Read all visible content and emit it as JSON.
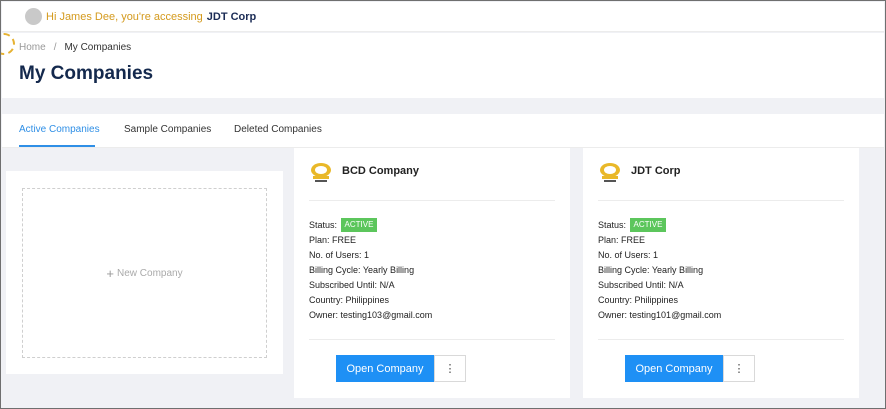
{
  "topbar": {
    "greeting": "Hi James Dee, you're accessing",
    "company": "JDT Corp"
  },
  "breadcrumb": {
    "home": "Home",
    "separator": "/",
    "current": "My Companies"
  },
  "page": {
    "title": "My Companies"
  },
  "tabs": [
    {
      "label": "Active Companies",
      "active": true
    },
    {
      "label": "Sample Companies",
      "active": false
    },
    {
      "label": "Deleted Companies",
      "active": false
    }
  ],
  "new_company": {
    "plus": "+",
    "label": "New Company"
  },
  "labels": {
    "status": "Status:",
    "plan": "Plan:",
    "users": "No. of Users:",
    "billing": "Billing Cycle:",
    "subscribed": "Subscribed Until:",
    "country": "Country:",
    "owner": "Owner:",
    "open": "Open Company",
    "more": "⋮"
  },
  "companies": [
    {
      "name": "BCD Company",
      "status": "ACTIVE",
      "plan": "FREE",
      "users": "1",
      "billing": "Yearly Billing",
      "subscribed": "N/A",
      "country": "Philippines",
      "owner": "testing103@gmail.com"
    },
    {
      "name": "JDT Corp",
      "status": "ACTIVE",
      "plan": "FREE",
      "users": "1",
      "billing": "Yearly Billing",
      "subscribed": "N/A",
      "country": "Philippines",
      "owner": "testing101@gmail.com"
    }
  ],
  "colors": {
    "accent": "#1e90f5",
    "status_active": "#5cc65c",
    "greeting": "#d49a1d",
    "title": "#14294d"
  }
}
